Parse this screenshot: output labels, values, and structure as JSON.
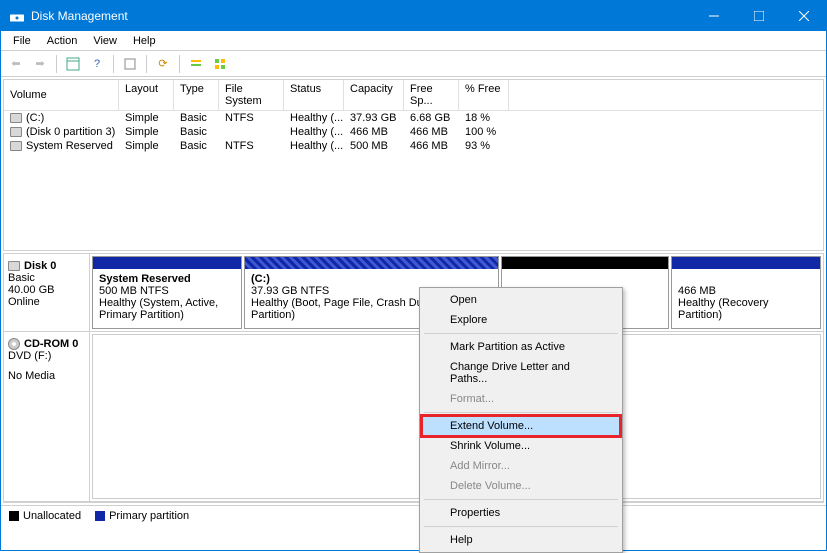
{
  "window": {
    "title": "Disk Management"
  },
  "menu": [
    "File",
    "Action",
    "View",
    "Help"
  ],
  "columns": {
    "volume": "Volume",
    "layout": "Layout",
    "type": "Type",
    "fs": "File System",
    "status": "Status",
    "cap": "Capacity",
    "free": "Free Sp...",
    "pct": "% Free"
  },
  "volumes": [
    {
      "name": "(C:)",
      "layout": "Simple",
      "type": "Basic",
      "fs": "NTFS",
      "status": "Healthy (...",
      "cap": "37.93 GB",
      "free": "6.68 GB",
      "pct": "18 %"
    },
    {
      "name": "(Disk 0 partition 3)",
      "layout": "Simple",
      "type": "Basic",
      "fs": "",
      "status": "Healthy (...",
      "cap": "466 MB",
      "free": "466 MB",
      "pct": "100 %"
    },
    {
      "name": "System Reserved",
      "layout": "Simple",
      "type": "Basic",
      "fs": "NTFS",
      "status": "Healthy (...",
      "cap": "500 MB",
      "free": "466 MB",
      "pct": "93 %"
    }
  ],
  "disk0": {
    "name": "Disk 0",
    "type": "Basic",
    "size": "40.00 GB",
    "state": "Online",
    "p1": {
      "name": "System Reserved",
      "line2": "500 MB NTFS",
      "line3": "Healthy (System, Active, Primary Partition)"
    },
    "p2": {
      "name": "(C:)",
      "line2": "37.93 GB NTFS",
      "line3": "Healthy (Boot, Page File, Crash Dump, Primary Partition)"
    },
    "p3": {
      "line2": "",
      "line3": ""
    },
    "p4": {
      "line2": "466 MB",
      "line3": "Healthy (Recovery Partition)"
    }
  },
  "cdrom": {
    "name": "CD-ROM 0",
    "line2": "DVD (F:)",
    "line3": "No Media"
  },
  "legend": {
    "unalloc": "Unallocated",
    "primary": "Primary partition"
  },
  "ctx": {
    "open": "Open",
    "explore": "Explore",
    "mark": "Mark Partition as Active",
    "letter": "Change Drive Letter and Paths...",
    "format": "Format...",
    "extend": "Extend Volume...",
    "shrink": "Shrink Volume...",
    "mirror": "Add Mirror...",
    "delete": "Delete Volume...",
    "props": "Properties",
    "help": "Help"
  }
}
